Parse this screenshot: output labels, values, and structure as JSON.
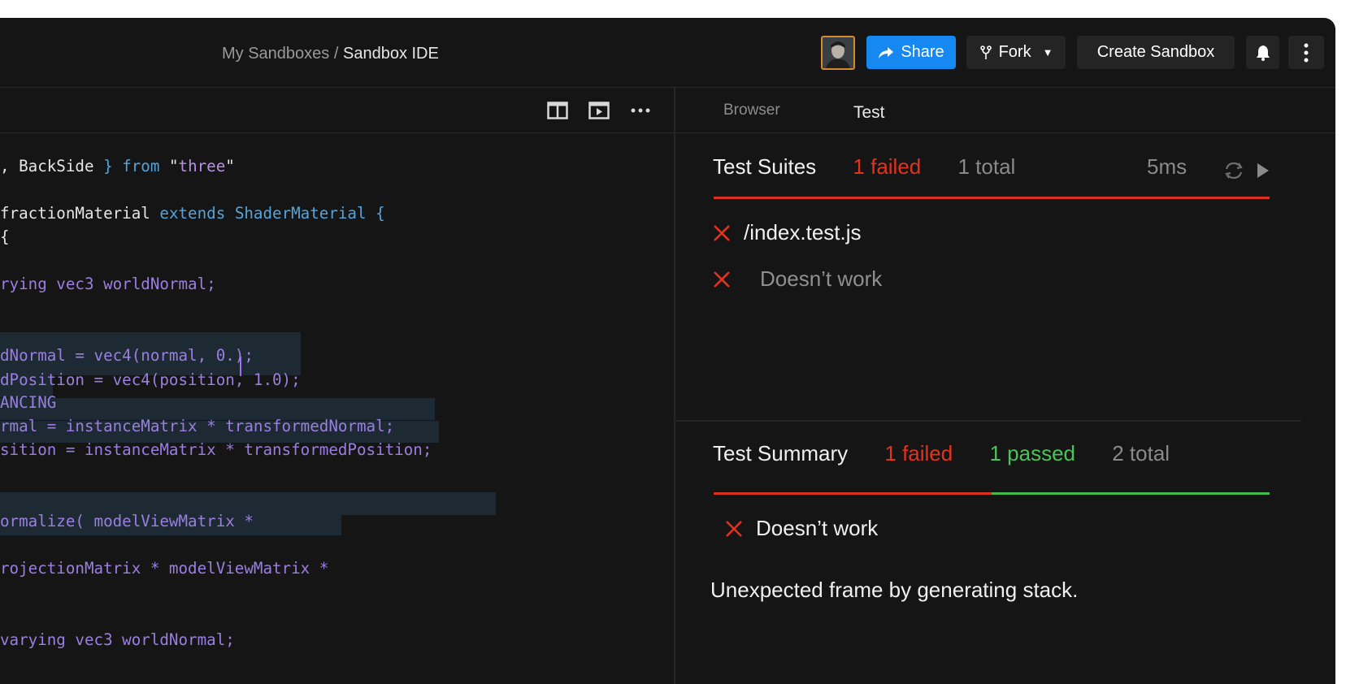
{
  "header": {
    "breadcrumb_parent": "My Sandboxes",
    "breadcrumb_sep": "/",
    "breadcrumb_current": "Sandbox IDE",
    "share_label": "Share",
    "fork_label": "Fork",
    "create_label": "Create Sandbox"
  },
  "code_lines": [
    {
      "parts": [
        [
          ", BackSide ",
          "white"
        ],
        [
          "} ",
          "blue"
        ],
        [
          "from ",
          "blue"
        ],
        [
          "\"",
          "white"
        ],
        [
          "three",
          "str"
        ],
        [
          "\"",
          "white"
        ]
      ]
    },
    {
      "parts": [
        [
          "fractionMaterial ",
          "white"
        ],
        [
          "extends ",
          "blue"
        ],
        [
          "ShaderMaterial ",
          "blue"
        ],
        [
          "{",
          "blue"
        ]
      ]
    },
    {
      "parts": [
        [
          "{",
          "white"
        ]
      ]
    },
    {
      "parts": [
        [
          "rying vec3 worldNormal;",
          "purple"
        ]
      ]
    },
    {
      "parts": [
        [
          "dNormal = vec4(normal, 0.);",
          "purple"
        ]
      ]
    },
    {
      "parts": [
        [
          "dPosition = vec4(position, 1.0);",
          "purple"
        ]
      ]
    },
    {
      "parts": [
        [
          "ANCING",
          "purple"
        ]
      ]
    },
    {
      "parts": [
        [
          "rmal = instanceMatrix * transformedNormal;",
          "purple"
        ]
      ]
    },
    {
      "parts": [
        [
          "sition = instanceMatrix * transformedPosition;",
          "purple"
        ]
      ]
    },
    {
      "parts": [
        [
          "ormalize( modelViewMatrix *",
          "purple"
        ]
      ]
    },
    {
      "parts": [
        [
          "rojectionMatrix * modelViewMatrix *",
          "purple"
        ]
      ]
    },
    {
      "parts": [
        [
          "varying vec3 worldNormal;",
          "purple"
        ]
      ]
    }
  ],
  "tabs": {
    "browser": "Browser",
    "test": "Test"
  },
  "suites": {
    "title": "Test Suites",
    "failed": "1 failed",
    "total": "1 total",
    "time": "5ms",
    "file": "/index.test.js",
    "test_name": "Doesn’t work"
  },
  "summary": {
    "title": "Test Summary",
    "failed": "1 failed",
    "passed": "1 passed",
    "total": "2 total",
    "failing_test": "Doesn’t work",
    "error": "Unexpected frame by generating stack.",
    "failed_fraction": 0.5,
    "passed_fraction": 0.5
  },
  "colors": {
    "accent": "#1588f2",
    "fail": "#e5321d",
    "pass": "#4cc257",
    "background": "#151515"
  },
  "icons": {
    "share": "share-arrow-icon",
    "fork": "fork-icon",
    "bell": "bell-icon",
    "more": "vertical-dots-icon",
    "split": "split-view-icon",
    "preview": "preview-icon",
    "ellipsis": "horizontal-dots-icon",
    "refresh": "refresh-icon",
    "run": "play-icon",
    "fail": "x-icon"
  }
}
